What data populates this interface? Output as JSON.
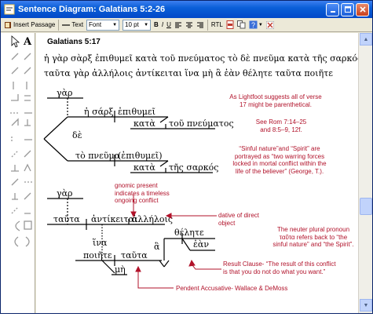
{
  "window": {
    "title": "Sentence Diagram: Galatians 5:2-26"
  },
  "toolbar": {
    "insert_passage": "Insert Passage",
    "text": "Text",
    "font": "Font",
    "size": "10 pt",
    "bold": "B",
    "italic": "I",
    "underline": "U",
    "rtl": "RTL"
  },
  "doc": {
    "heading": "Galatians 5:17",
    "verse_line1": "ἡ γὰρ σὰρξ ἐπιθυμεῖ κατὰ τοῦ πνεύματος τὸ δὲ πνεῦμα κατὰ τῆς σαρκός",
    "verse_line2": "ταῦτα γὰρ ἀλλήλοις ἀντίκειται ἵνα μὴ ἃ ἐὰν θέλητε ταῦτα ποιῆτε"
  },
  "diagram1": {
    "gar": "γὰρ",
    "sarx": "ἡ σάρξ",
    "epithymei": "ἐπιθυμεῖ",
    "kata1": "κατὰ",
    "tou_pneumatos": "τοῦ πνεύματος",
    "de": "δὲ",
    "to_pneuma": "τὸ πνεῦμα",
    "epithymei2": "(ἐπιθυμεῖ)",
    "kata2": "κατὰ",
    "tes_sarkos": "τῆς σαρκός"
  },
  "diagram2": {
    "gar": "γὰρ",
    "tauta": "ταῦτα",
    "antikeitai": "ἀντίκειται",
    "allelois": "ἀλλήλοις",
    "hina": "ἵνα",
    "thelete": "θέλητε",
    "ha": "ἃ",
    "ean": "ἐὰν",
    "poiete": "ποιῆτε",
    "tauta2": "ταῦτα",
    "me": "μὴ"
  },
  "notes": {
    "n1": "As Lightfoot suggests all of verse 17 might be parenthetical.",
    "n2": "See Rom 7:14–25 and 8:5–9, 12f.",
    "n3": "“Sinful nature”and “Spirit” are portrayed as “two warring forces locked in mortal conflict within the life of the believer” (George, T.).",
    "n4": "gnomic present indicates a timeless ongoing conflict",
    "n5": "dative of direct object",
    "n6": "The neuter plural pronoun ταῦτα refers back to “the sinful nature” and “the Spirit”.",
    "n7": "Result Clause- “The result of this conflict is that you do not do what you want.”",
    "n8": "Pendent Accusative- Wallace & DeMoss"
  },
  "colors": {
    "note": "#b1122a",
    "title_bar": "#0a5fd8"
  }
}
